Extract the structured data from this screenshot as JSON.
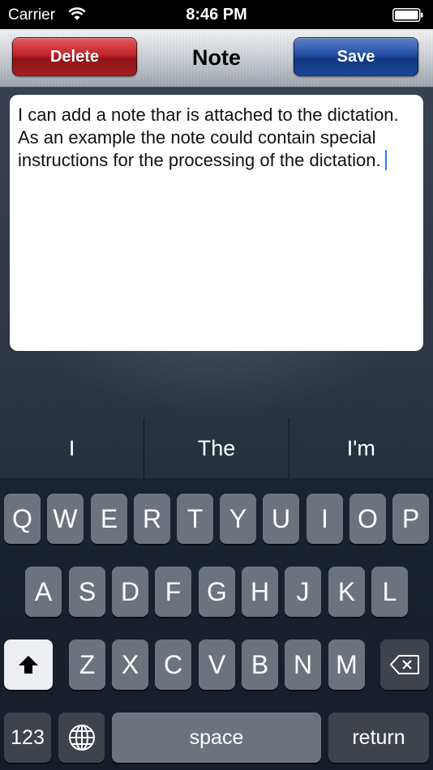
{
  "status_bar": {
    "carrier": "Carrier",
    "time": "8:46 PM"
  },
  "nav": {
    "delete_label": "Delete",
    "title": "Note",
    "save_label": "Save"
  },
  "note": {
    "text": "I can add a note thar is attached to the dictation. As an example the note could contain special instructions for the processing of the dictation."
  },
  "suggestions": [
    "I",
    "The",
    "I'm"
  ],
  "keyboard": {
    "row1": [
      "Q",
      "W",
      "E",
      "R",
      "T",
      "Y",
      "U",
      "I",
      "O",
      "P"
    ],
    "row2": [
      "A",
      "S",
      "D",
      "F",
      "G",
      "H",
      "J",
      "K",
      "L"
    ],
    "row3": [
      "Z",
      "X",
      "C",
      "V",
      "B",
      "N",
      "M"
    ],
    "numbers_label": "123",
    "space_label": "space",
    "return_label": "return"
  },
  "colors": {
    "delete_button": "#c2242a",
    "save_button": "#2450a6",
    "caret": "#3478f6"
  }
}
